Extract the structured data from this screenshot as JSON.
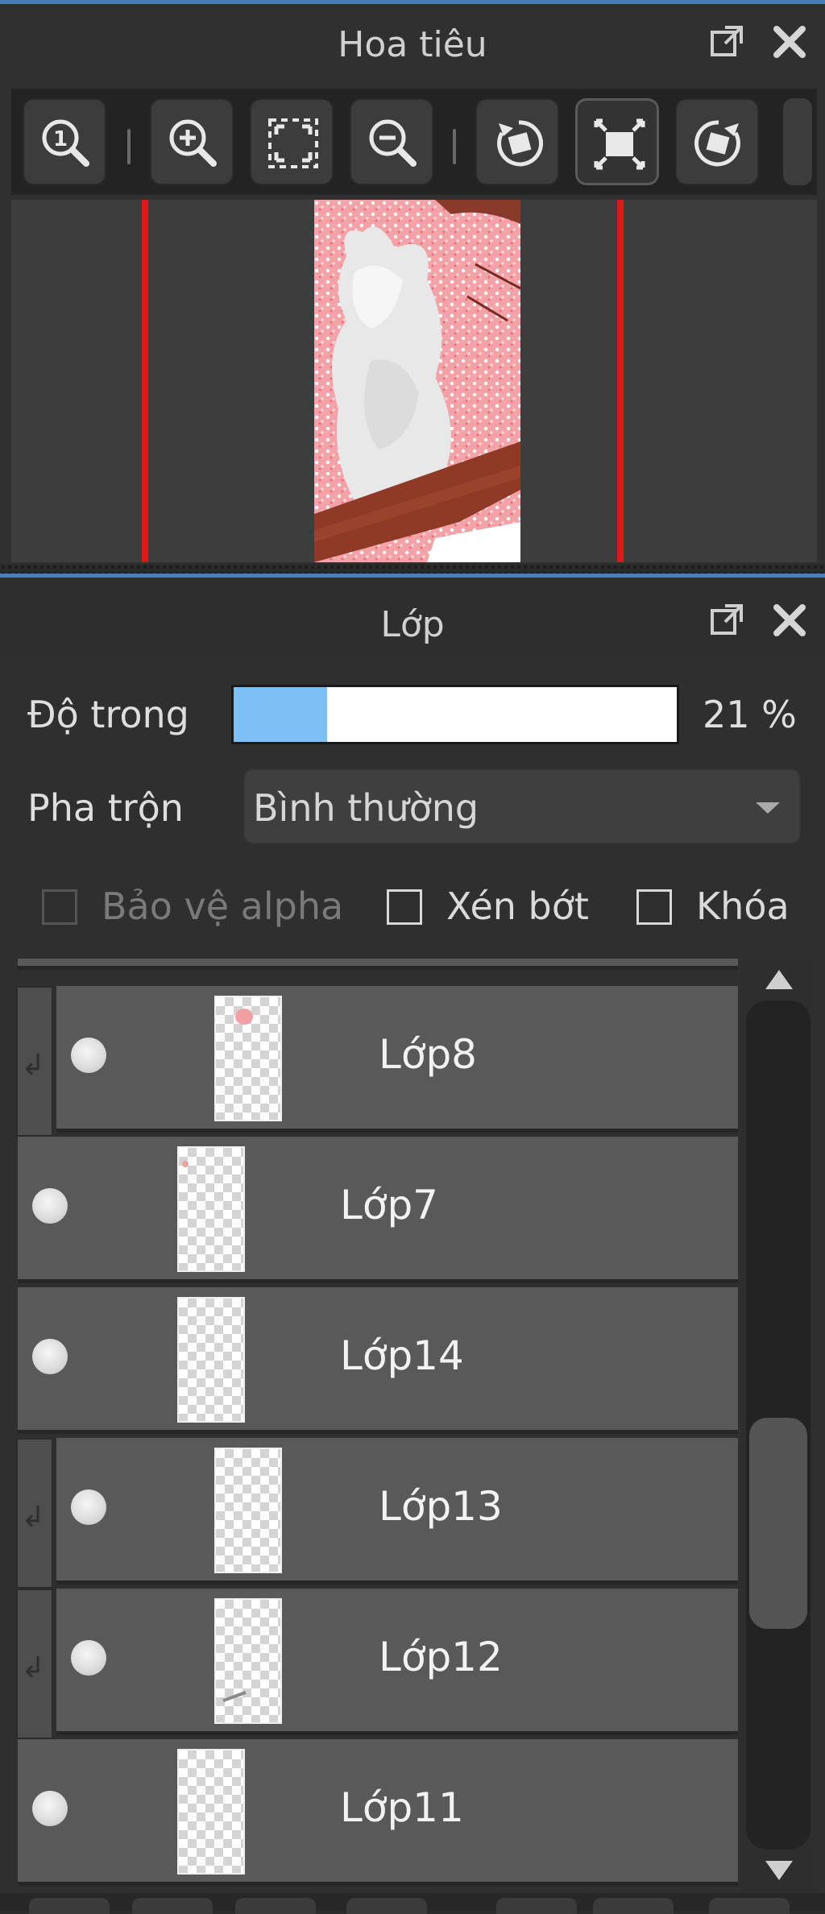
{
  "navigator": {
    "title": "Hoa tiêu",
    "toolbar": [
      {
        "name": "zoom-actual-size-icon"
      },
      {
        "name": "zoom-in-icon"
      },
      {
        "name": "fit-screen-icon"
      },
      {
        "name": "zoom-out-icon"
      },
      {
        "name": "rotate-left-icon"
      },
      {
        "name": "reset-view-icon"
      },
      {
        "name": "rotate-right-icon"
      }
    ]
  },
  "layers": {
    "title": "Lớp",
    "opacity_label": "Độ trong",
    "opacity_value": "21 %",
    "opacity_fraction": 0.21,
    "blend_label": "Pha trộn",
    "blend_mode": "Bình thường",
    "protect_alpha_label": "Bảo vệ alpha",
    "clip_label": "Xén bớt",
    "lock_label": "Khóa",
    "protect_alpha_checked": false,
    "clip_checked": false,
    "lock_checked": false,
    "items": [
      {
        "name": "Lớp8",
        "clipped": true
      },
      {
        "name": "Lớp7",
        "clipped": false
      },
      {
        "name": "Lớp14",
        "clipped": false
      },
      {
        "name": "Lớp13",
        "clipped": true
      },
      {
        "name": "Lớp12",
        "clipped": true
      },
      {
        "name": "Lớp11",
        "clipped": false
      }
    ]
  },
  "colors": {
    "accent": "#4a7fb5",
    "opacity_fill": "#7cc0f5",
    "frame_lines": "#e01818"
  }
}
